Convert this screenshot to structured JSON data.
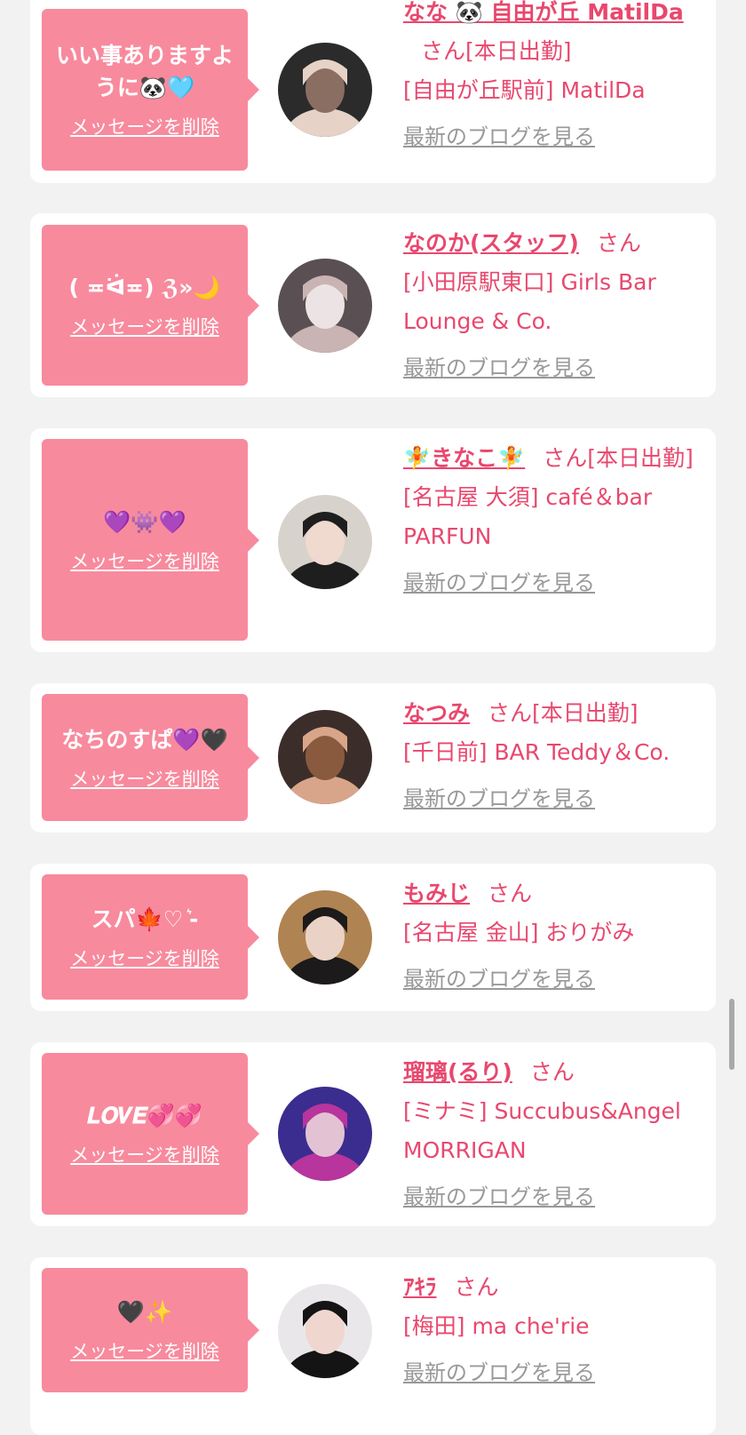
{
  "entries": [
    {
      "message": "いい事ありますように🐼🩵",
      "delete_label": "メッセージを削除",
      "name": "なな 🐼 自由が丘 MatilDa",
      "honorific": "さん",
      "status": "[本日出勤]",
      "store": "[自由が丘駅前] MatilDa",
      "blog_label": "最新のブログを見る",
      "avatar_colors": [
        "#2b2b2b",
        "#e7d2c7",
        "#8a6e62"
      ]
    },
    {
      "message": "( ≖ᐛ≖) ℨ»🌙",
      "delete_label": "メッセージを削除",
      "name": "なのか(スタッフ)",
      "honorific": "さん",
      "status": "",
      "store": "[小田原駅東口] Girls Bar Lounge & Co.",
      "blog_label": "最新のブログを見る",
      "avatar_colors": [
        "#5a4f52",
        "#c9b3b3",
        "#ece4e4"
      ]
    },
    {
      "message": "💜👾💜",
      "delete_label": "メッセージを削除",
      "name": "🧚きなこ🧚",
      "honorific": "さん",
      "status": "[本日出勤]",
      "store": "[名古屋 大須] café＆bar PARFUN",
      "blog_label": "最新のブログを見る",
      "avatar_colors": [
        "#d8d2cc",
        "#1e1e1e",
        "#f0d9cf"
      ]
    },
    {
      "message": "なちのすぱ💜🖤",
      "delete_label": "メッセージを削除",
      "name": "なつみ",
      "honorific": "さん",
      "status": "[本日出勤]",
      "store": "[千日前] BAR Teddy＆Co.",
      "blog_label": "最新のブログを見る",
      "avatar_colors": [
        "#3b2e2a",
        "#d8a58a",
        "#8a5a3f"
      ]
    },
    {
      "message": "スパ🍁♡ ͛-",
      "delete_label": "メッセージを削除",
      "name": "もみじ",
      "honorific": "さん",
      "status": "",
      "store": "[名古屋 金山] おりがみ",
      "blog_label": "最新のブログを見る",
      "avatar_colors": [
        "#b08352",
        "#1c1a1a",
        "#ead3c6"
      ]
    },
    {
      "message": "𝑳𝑶𝑽𝑬💞💞",
      "delete_label": "メッセージを削除",
      "name": "瑠璃(るり)",
      "honorific": "さん",
      "status": "",
      "store": "[ミナミ] Succubus&Angel MORRIGAN",
      "blog_label": "最新のブログを見る",
      "avatar_colors": [
        "#3a2d8f",
        "#b7359c",
        "#e3c2d3"
      ]
    },
    {
      "message": "🖤✨",
      "delete_label": "メッセージを削除",
      "name": "ｱｷﾗ",
      "honorific": "さん",
      "status": "",
      "store": "[梅田] ma che'rie",
      "blog_label": "最新のブログを見る",
      "avatar_colors": [
        "#e9e7ea",
        "#141414",
        "#efd6cf"
      ]
    }
  ],
  "colors": {
    "accent": "#e8486e",
    "bubble": "#f88a9d",
    "muted": "#999999",
    "background": "#f2f2f2"
  }
}
